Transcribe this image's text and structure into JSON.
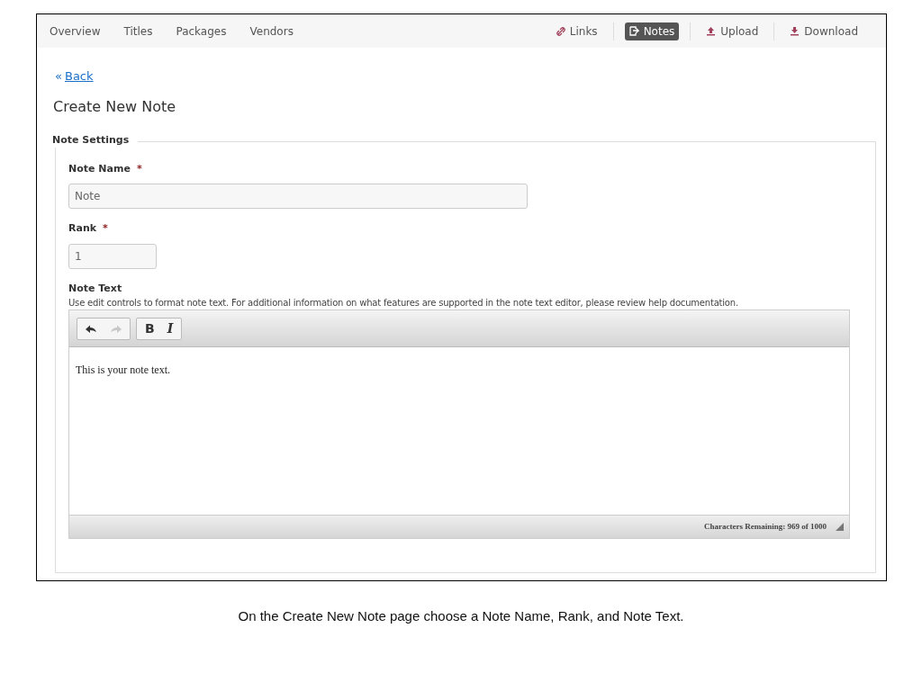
{
  "nav": {
    "tabs": [
      {
        "label": "Overview",
        "selected": false
      },
      {
        "label": "Titles",
        "selected": false
      },
      {
        "label": "Packages",
        "selected": false
      },
      {
        "label": "Vendors",
        "selected": false
      }
    ],
    "actions": [
      {
        "kind": "link",
        "label": "Links",
        "selected": false
      },
      {
        "kind": "notes",
        "label": "Notes",
        "selected": true
      },
      {
        "kind": "upload",
        "label": "Upload",
        "selected": false
      },
      {
        "kind": "download",
        "label": "Download",
        "selected": false
      }
    ]
  },
  "back_link": {
    "arrow": "«",
    "label": "Back"
  },
  "title": "Create New Note",
  "fieldset": {
    "legend": "Note Settings",
    "fields": [
      {
        "label": "Note Name",
        "required_mark": "*",
        "value": "Note",
        "kind": "wide"
      },
      {
        "label": "Rank",
        "required_mark": "*",
        "value": "1",
        "kind": "narrow"
      }
    ],
    "note_text": {
      "label": "Note Text",
      "help": "Use edit controls to format note text. For additional information on what features are supported in the note text editor, please review help documentation.",
      "history_buttons": [
        {
          "kind": "undo",
          "disabled": false
        },
        {
          "kind": "redo",
          "disabled": true
        }
      ],
      "format_buttons": [
        {
          "kind": "bold",
          "label": "B"
        },
        {
          "kind": "italic",
          "label": "I"
        }
      ],
      "content": "This is your note text.",
      "counter": "Characters Remaining: 969 of 1000"
    }
  },
  "caption": "On the Create New Note page choose a Note Name, Rank, and Note Text."
}
